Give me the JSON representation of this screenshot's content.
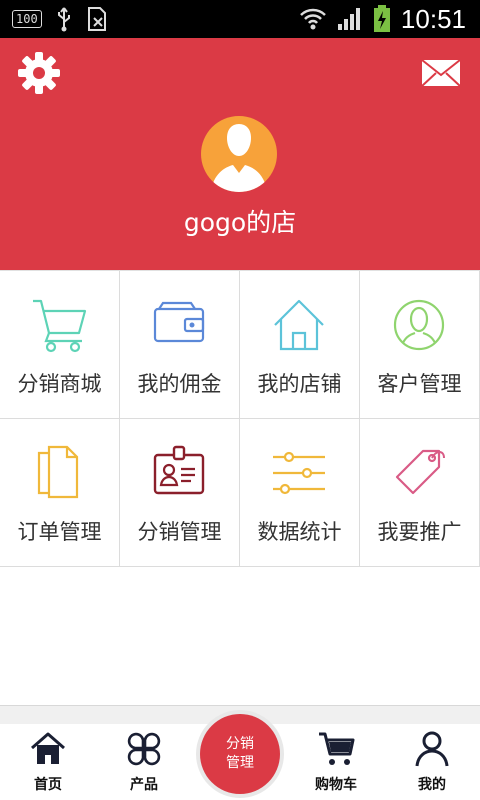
{
  "status_bar": {
    "badge": "100",
    "time": "10:51"
  },
  "header": {
    "shop_name": "gogo的店",
    "settings_icon": "gear-icon",
    "message_icon": "envelope-icon"
  },
  "menu": {
    "items": [
      {
        "label": "分销商城",
        "icon": "shopping-cart-icon",
        "color": "#5dd3b6"
      },
      {
        "label": "我的佣金",
        "icon": "wallet-icon",
        "color": "#5b88d8"
      },
      {
        "label": "我的店铺",
        "icon": "house-icon",
        "color": "#5cc3d9"
      },
      {
        "label": "客户管理",
        "icon": "user-circle-icon",
        "color": "#8fd46e"
      },
      {
        "label": "订单管理",
        "icon": "documents-icon",
        "color": "#f0b83a"
      },
      {
        "label": "分销管理",
        "icon": "id-badge-icon",
        "color": "#8b1f2b"
      },
      {
        "label": "数据统计",
        "icon": "sliders-icon",
        "color": "#f0b83a"
      },
      {
        "label": "我要推广",
        "icon": "price-tag-icon",
        "color": "#d95b86"
      }
    ]
  },
  "tabbar": {
    "home": "首页",
    "products": "产品",
    "center": "分销\n管理",
    "cart": "购物车",
    "mine": "我的"
  },
  "colors": {
    "brand_red": "#db3a45",
    "avatar_bg": "#f7a23a"
  }
}
